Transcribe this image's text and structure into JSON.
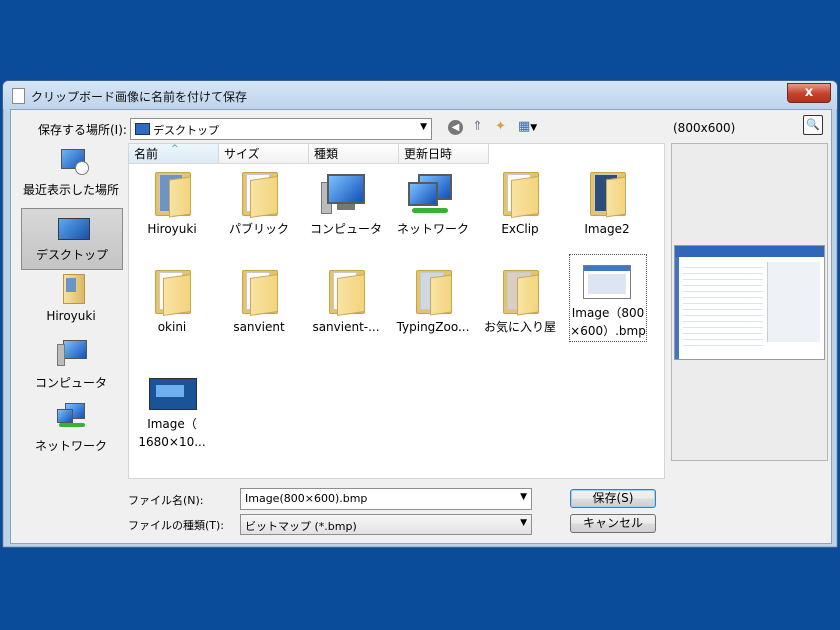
{
  "window": {
    "title": "クリップボード画像に名前を付けて保存",
    "close_glyph": "x"
  },
  "location": {
    "label": "保存する場所(I):",
    "value": "デスクトップ",
    "arrow": "▼"
  },
  "toolbar": {
    "back_glyph": "◀",
    "up_glyph": "⇑",
    "new_folder_glyph": "✦",
    "views_glyph": "▦",
    "views_arrow": "▼"
  },
  "places": [
    {
      "label": "最近表示した場所",
      "icon": "recent-places-icon"
    },
    {
      "label": "デスクトップ",
      "icon": "desktop-icon",
      "selected": true
    },
    {
      "label": "Hiroyuki",
      "icon": "user-folder-icon"
    },
    {
      "label": "コンピュータ",
      "icon": "computer-icon"
    },
    {
      "label": "ネットワーク",
      "icon": "network-icon"
    }
  ],
  "columns": [
    "名前",
    "サイズ",
    "種類",
    "更新日時"
  ],
  "sort_glyph": "^",
  "files": [
    {
      "name": "Hiroyuki",
      "icon": "user-folder-icon"
    },
    {
      "name": "パブリック",
      "icon": "folder-icon"
    },
    {
      "name": "コンピュータ",
      "icon": "computer-icon"
    },
    {
      "name": "ネットワーク",
      "icon": "network-icon"
    },
    {
      "name": "ExClip",
      "icon": "folder-icon"
    },
    {
      "name": "Image2",
      "icon": "folder-icon"
    },
    {
      "name": "okini",
      "icon": "folder-icon"
    },
    {
      "name": "sanvient",
      "icon": "folder-icon"
    },
    {
      "name": "sanvient-...",
      "icon": "folder-icon"
    },
    {
      "name": "TypingZoo...",
      "icon": "folder-icon"
    },
    {
      "name": "お気に入り屋",
      "icon": "folder-icon"
    },
    {
      "name_line1": "Image（800",
      "name_line2": "×600）.bmp",
      "icon": "bitmap-image-icon",
      "focused": true
    },
    {
      "name_line1": "Image（",
      "name_line2": "1680×10...",
      "icon": "bitmap-image-icon"
    }
  ],
  "preview": {
    "size_label": "(800x600)",
    "button_glyph": "🔍"
  },
  "filename": {
    "label": "ファイル名(N):",
    "value": "Image(800×600).bmp",
    "arrow": "▼"
  },
  "filetype": {
    "label": "ファイルの種類(T):",
    "value": "ビットマップ (*.bmp)",
    "arrow": "▼"
  },
  "buttons": {
    "save": "保存(S)",
    "cancel": "キャンセル"
  }
}
